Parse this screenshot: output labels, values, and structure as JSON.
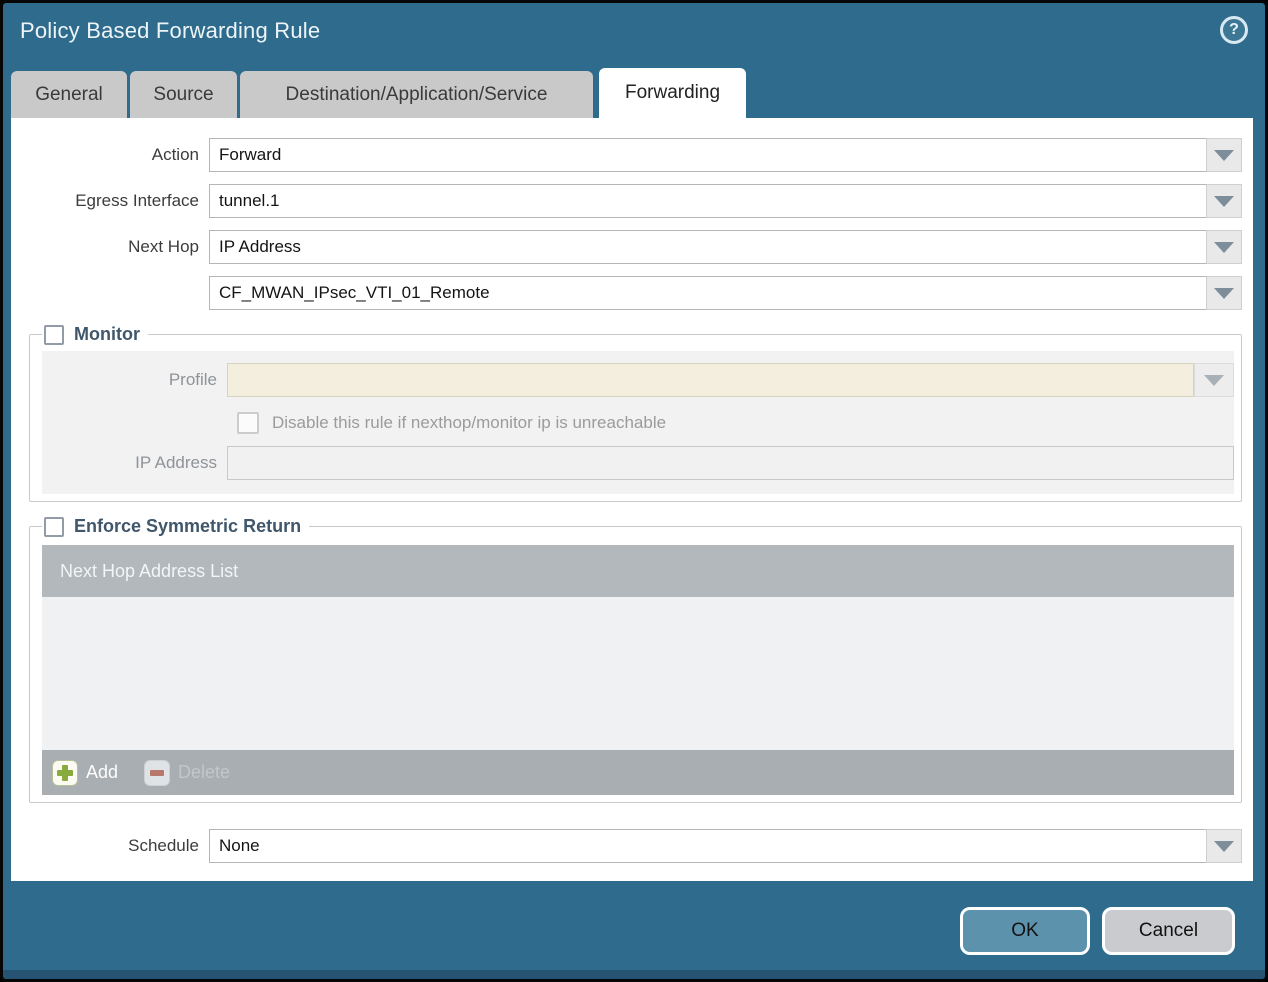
{
  "window": {
    "title": "Policy Based Forwarding Rule",
    "help_icon": "?"
  },
  "tabs": [
    {
      "label": "General",
      "active": false
    },
    {
      "label": "Source",
      "active": false
    },
    {
      "label": "Destination/Application/Service",
      "active": false
    },
    {
      "label": "Forwarding",
      "active": true
    }
  ],
  "form": {
    "action": {
      "label": "Action",
      "value": "Forward"
    },
    "egress_interface": {
      "label": "Egress Interface",
      "value": "tunnel.1"
    },
    "next_hop": {
      "label": "Next Hop",
      "value": "IP Address"
    },
    "next_hop_address": {
      "value": "CF_MWAN_IPsec_VTI_01_Remote"
    },
    "schedule": {
      "label": "Schedule",
      "value": "None"
    }
  },
  "monitor": {
    "legend": "Monitor",
    "checked": false,
    "profile": {
      "label": "Profile",
      "value": ""
    },
    "disable_rule_label": "Disable this rule if nexthop/monitor ip is unreachable",
    "disable_rule_checked": false,
    "ip_address": {
      "label": "IP Address",
      "value": ""
    }
  },
  "symmetric_return": {
    "legend": "Enforce Symmetric Return",
    "checked": false,
    "table_header": "Next Hop Address List",
    "rows": [],
    "add_label": "Add",
    "delete_label": "Delete",
    "delete_enabled": false
  },
  "footer": {
    "ok_label": "OK",
    "cancel_label": "Cancel"
  },
  "colors": {
    "titlebar_teal": "#2e6b8c",
    "active_tab": "#ffffff",
    "inactive_tab": "#c9c9c9",
    "table_header_gray": "#b2b8bc",
    "table_footer_gray": "#a9aeb3",
    "profile_field_beige": "#f3eedd",
    "add_plus_green": "#89aa3e",
    "delete_minus_red": "#b5786b",
    "ok_button_blue": "#5d92ac",
    "cancel_button_gray": "#c9cbce"
  }
}
